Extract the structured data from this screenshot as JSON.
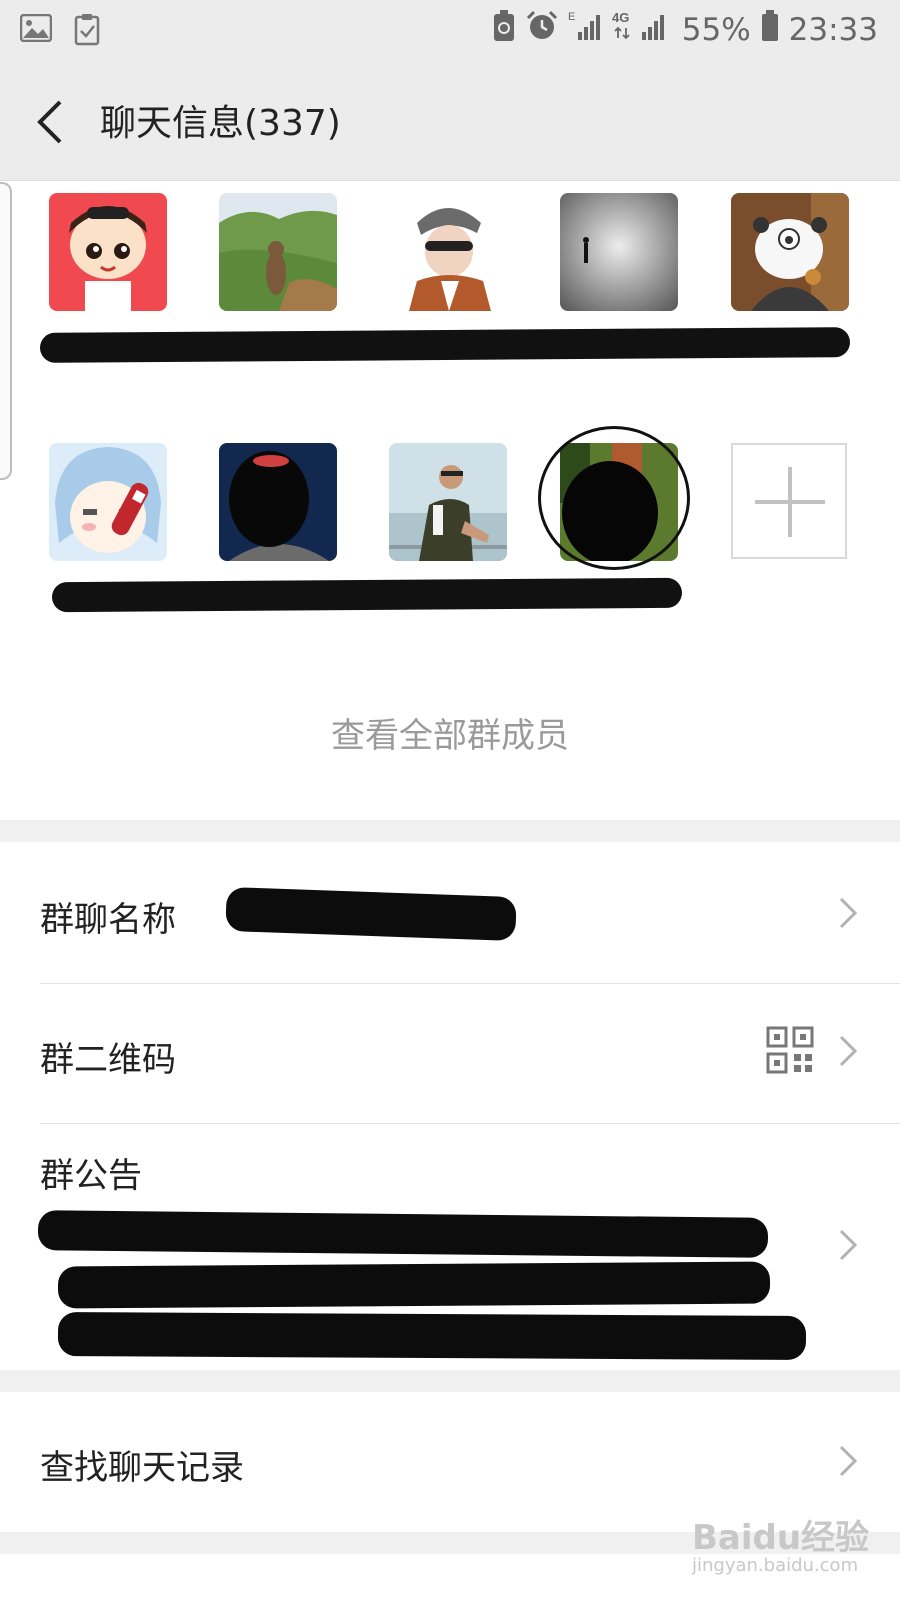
{
  "status_bar": {
    "battery": "55%",
    "time": "23:33",
    "network_left": "E",
    "network_right": "4G"
  },
  "header": {
    "title": "聊天信息(337)"
  },
  "members": {
    "row1": [
      "avatar-cartoon-boy",
      "avatar-marmot-landscape",
      "avatar-man-sunglasses",
      "avatar-figure-in-fog",
      "avatar-panda-cookie"
    ],
    "row2": [
      "avatar-anime-girl-cola",
      "avatar-redacted-dark",
      "avatar-man-seaside",
      "avatar-redacted-circled"
    ],
    "view_all": "查看全部群成员"
  },
  "settings": {
    "group_name_label": "群聊名称",
    "qr_code_label": "群二维码",
    "announcement_label": "群公告",
    "search_history_label": "查找聊天记录"
  },
  "watermark": {
    "brand": "Baidu经验",
    "url": "jingyan.baidu.com"
  },
  "colors": {
    "header_bg": "#ececec",
    "gap_bg": "#f0f0f0",
    "redaction": "#0c0c0c"
  }
}
